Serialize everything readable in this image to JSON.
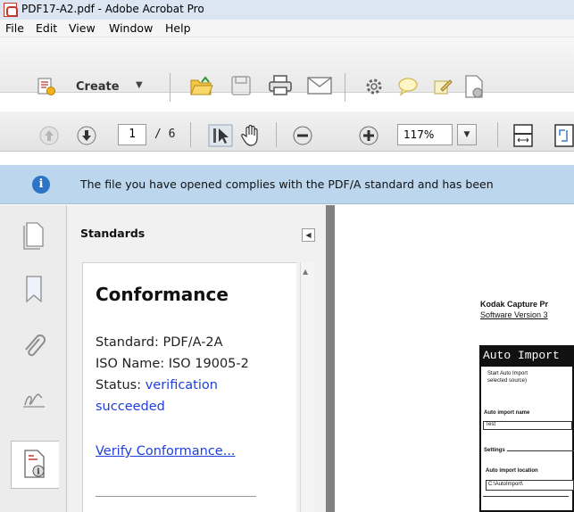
{
  "window": {
    "title": "PDF17-A2.pdf - Adobe Acrobat Pro"
  },
  "menu": [
    "File",
    "Edit",
    "View",
    "Window",
    "Help"
  ],
  "toolbar": {
    "create_label": "Create",
    "icons": [
      "open-folder-icon",
      "save-icon",
      "print-icon",
      "email-icon",
      "settings-gear-icon",
      "comment-icon",
      "sign-icon",
      "document-icon"
    ]
  },
  "navigation": {
    "current_page": "1",
    "total_pages": "/ 6",
    "zoom": "117%"
  },
  "infobar": {
    "message": "The file you have opened complies with the PDF/A standard and has been"
  },
  "panel": {
    "header": "Standards",
    "conformance_title": "Conformance",
    "standard_line": "Standard: PDF/A-2A",
    "iso_line": "ISO Name: ISO 19005-2",
    "status_label": "Status: ",
    "status_value_line1": "verification",
    "status_value_line2": "succeeded",
    "verify_link": "Verify Conformance..."
  },
  "document": {
    "line1": "Kodak Capture Pr",
    "line2": "Software Version 3",
    "shot_title": "Auto Import",
    "shot_text1": "Start Auto Import",
    "shot_text2": "selected source)",
    "shot_text3": "Auto import name",
    "shot_text4": "Test",
    "shot_text5": "Settings",
    "shot_text6": "Auto import location",
    "shot_text7": "C:\\AutoImport\\"
  },
  "colors": {
    "infobar_bg": "#bcd6ee",
    "link_blue": "#1f3fd8",
    "doc_bg": "#808080"
  }
}
